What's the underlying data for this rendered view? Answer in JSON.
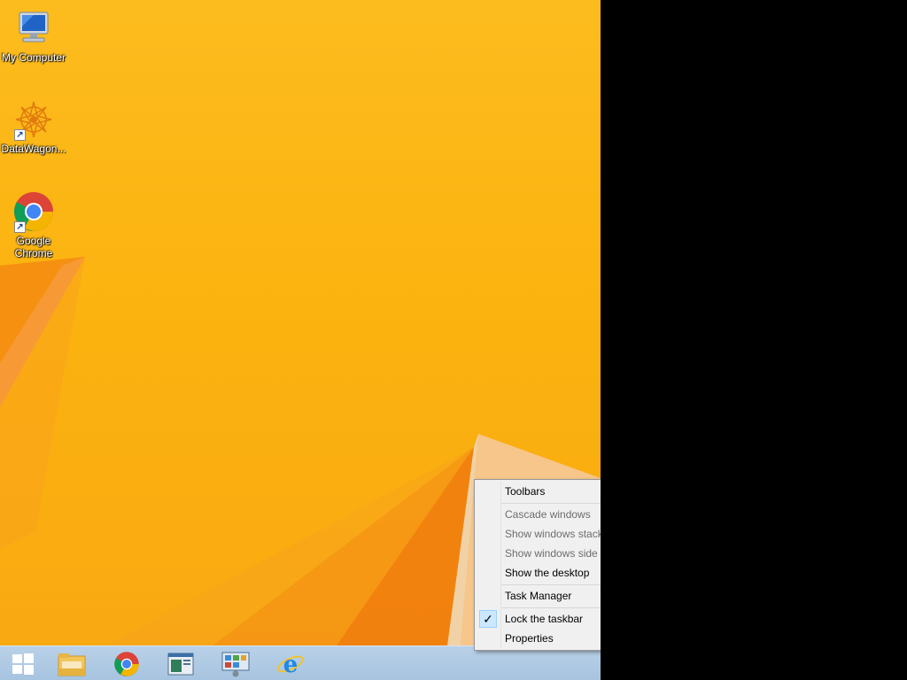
{
  "desktop": {
    "icons": [
      {
        "label": "My Computer",
        "icon": "computer-icon"
      },
      {
        "label": "DataWagon...",
        "icon": "datawagon-icon"
      },
      {
        "label": "Google Chrome",
        "icon": "chrome-icon"
      }
    ]
  },
  "taskbar": {
    "items": [
      {
        "name": "start-button",
        "icon": "windows-logo-icon"
      },
      {
        "name": "file-explorer",
        "icon": "folder-icon"
      },
      {
        "name": "google-chrome",
        "icon": "chrome-icon"
      },
      {
        "name": "app-window",
        "icon": "window-icon"
      },
      {
        "name": "control-panel",
        "icon": "control-panel-icon"
      },
      {
        "name": "internet-explorer",
        "icon": "ie-icon"
      }
    ]
  },
  "context_menu": {
    "items": [
      {
        "label": "Toolbars",
        "enabled": true,
        "submenu": true
      },
      {
        "label": "Cascade windows",
        "enabled": false
      },
      {
        "label": "Show windows stacked",
        "enabled": false
      },
      {
        "label": "Show windows side by side",
        "enabled": false
      },
      {
        "label": "Show the desktop",
        "enabled": true
      },
      {
        "label": "Task Manager",
        "enabled": true
      },
      {
        "label": "Lock the taskbar",
        "enabled": true,
        "checked": true
      },
      {
        "label": "Properties",
        "enabled": true
      }
    ],
    "submenu_glyph": "▶",
    "check_glyph": "✓"
  },
  "colors": {
    "wallpaper_base": "#fbb30f",
    "wallpaper_fold": "#f07a0e",
    "taskbar": "#a6c3df",
    "menu_bg": "#f0f0f0"
  }
}
